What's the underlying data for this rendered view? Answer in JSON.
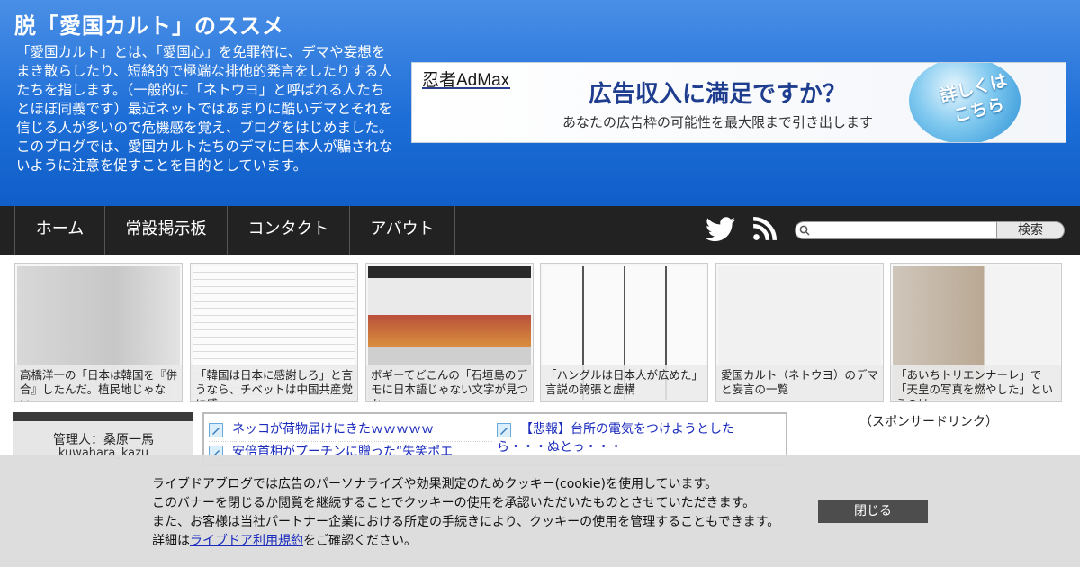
{
  "site": {
    "title": "脱「愛国カルト」のススメ",
    "description": "「愛国カルト」とは、「愛国心」を免罪符に、デマや妄想をまき散らしたり、短絡的で極端な排他的発言をしたりする人たちを指します。（一般的に「ネトウヨ」と呼ばれる人たちとほぼ同義です）最近ネットではあまりに酷いデマとそれを信じる人が多いので危機感を覚え、ブログをはじめました。このブログでは、愛国カルトたちのデマに日本人が騙されないように注意を促すことを目的としています。"
  },
  "ad": {
    "logo": "忍者AdMax",
    "headline": "広告収入に満足ですか？",
    "subline": "あなたの広告枠の可能性を最大限まで引き出します",
    "bubble": "詳しくは こちら"
  },
  "nav": {
    "items": [
      "ホーム",
      "常設掲示板",
      "コンタクト",
      "アバウト"
    ],
    "search_label": "検索",
    "search_placeholder": ""
  },
  "thumbnails": [
    {
      "caption": "高橋洋一の「日本は韓国を『併合』したんだ。植民地じゃない」"
    },
    {
      "caption": "「韓国は日本に感謝しろ」と言うなら、チベットは中国共産党に感"
    },
    {
      "caption": "ボギーてどこんの「石垣島のデモに日本語じゃない文字が見つかっ"
    },
    {
      "caption": "「ハングルは日本人が広めた」言説の誇張と虚構"
    },
    {
      "caption": "愛国カルト（ネトウヨ）のデマと妄言の一覧"
    },
    {
      "caption": "「あいちトリエンナーレ」で「天皇の写真を燃やした」というのは"
    }
  ],
  "sidebar": {
    "admin": "管理人：桑原一馬",
    "admin_id": "kuwahara_kazu"
  },
  "related": [
    {
      "title": "ネッコが荷物届けにきたｗｗｗｗｗ"
    },
    {
      "title": "【悲報】台所の電気をつけようとしたら・・・ぬとっ・・・"
    },
    {
      "title": "安倍首相がプーチンに贈った“失笑ポエ"
    }
  ],
  "sponsor_label": "（スポンサードリンク）",
  "cookie": {
    "line1": "ライブドアブログでは広告のパーソナライズや効果測定のためクッキー(cookie)を使用しています。",
    "line2": "このバナーを閉じるか閲覧を継続することでクッキーの使用を承認いただいたものとさせていただきます。",
    "line3": "また、お客様は当社パートナー企業における所定の手続きにより、クッキーの使用を管理することもできます。",
    "line4_prefix": "詳細は",
    "line4_link": "ライブドア利用規約",
    "line4_suffix": "をご確認ください。",
    "close_label": "閉じる"
  },
  "colors": {
    "header_blue": "#1f6fd8",
    "nav_bg": "#222222",
    "link_blue": "#1a2bbd",
    "close_btn": "#4d4d4d"
  }
}
